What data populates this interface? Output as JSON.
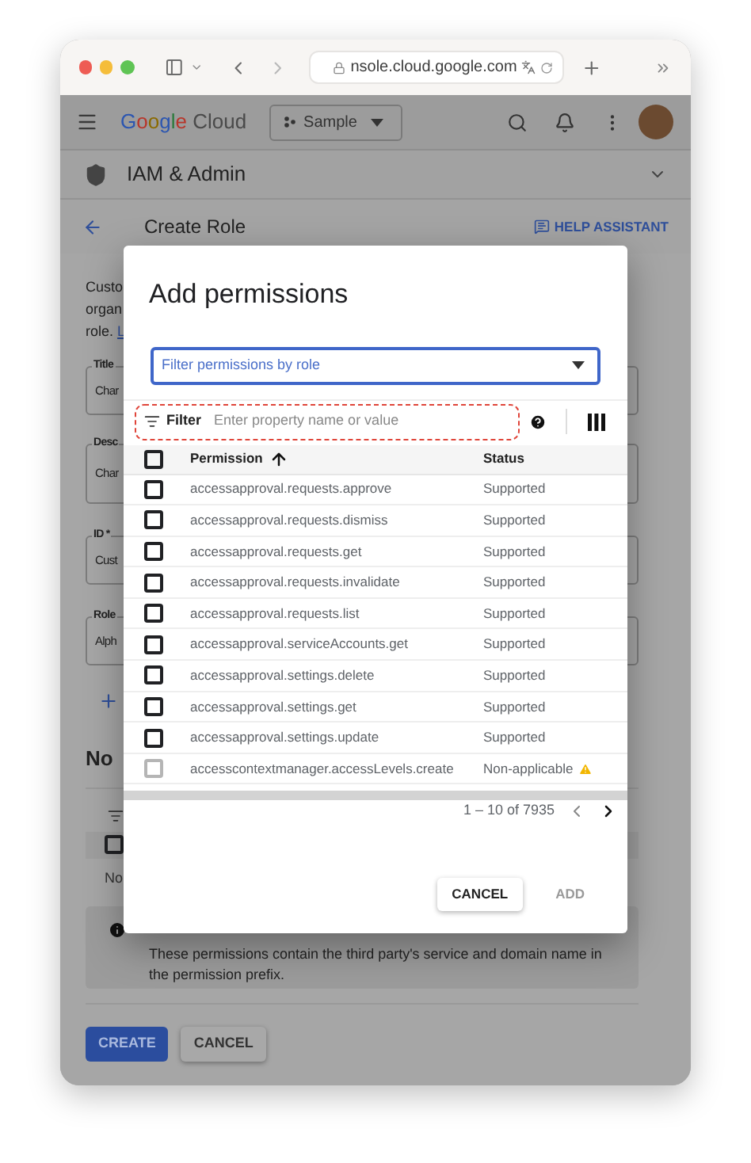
{
  "browser": {
    "url": "nsole.cloud.google.com"
  },
  "app_bar": {
    "brand": "Google",
    "product": "Cloud",
    "project": "Sample"
  },
  "section": {
    "title": "IAM & Admin"
  },
  "page": {
    "title": "Create Role",
    "help": "HELP ASSISTANT"
  },
  "form": {
    "intro_lines": [
      "Custo",
      "organ",
      "role."
    ],
    "intro_link": "L",
    "fields": [
      {
        "label": "Title",
        "value": "Char"
      },
      {
        "label": "Desc",
        "value": "Char"
      },
      {
        "label": "ID *",
        "value": "Cust"
      },
      {
        "label": "Role",
        "value": "Alph"
      }
    ],
    "heading": "No",
    "select_all": {
      "checked": false
    },
    "empty_text": "No",
    "info": "These permissions contain the third party's service and domain name in the permission prefix.",
    "buttons": [
      {
        "label": "CREATE",
        "kind": "primary"
      },
      {
        "label": "CANCEL",
        "kind": "secondary"
      }
    ]
  },
  "dialog": {
    "title": "Add permissions",
    "role_filter": {
      "placeholder": "Filter permissions by role"
    },
    "filter": {
      "label": "Filter",
      "placeholder": "Enter property name or value"
    },
    "select_all": {
      "checked": false
    },
    "columns": [
      "Permission",
      "Status"
    ],
    "rows": [
      {
        "permission": "accessapproval.requests.approve",
        "status": "Supported",
        "kind": "supported",
        "checked": false
      },
      {
        "permission": "accessapproval.requests.dismiss",
        "status": "Supported",
        "kind": "supported",
        "checked": false
      },
      {
        "permission": "accessapproval.requests.get",
        "status": "Supported",
        "kind": "supported",
        "checked": false
      },
      {
        "permission": "accessapproval.requests.invalidate",
        "status": "Supported",
        "kind": "supported",
        "checked": false
      },
      {
        "permission": "accessapproval.requests.list",
        "status": "Supported",
        "kind": "supported",
        "checked": false
      },
      {
        "permission": "accessapproval.serviceAccounts.get",
        "status": "Supported",
        "kind": "supported",
        "checked": false
      },
      {
        "permission": "accessapproval.settings.delete",
        "status": "Supported",
        "kind": "supported",
        "checked": false
      },
      {
        "permission": "accessapproval.settings.get",
        "status": "Supported",
        "kind": "supported",
        "checked": false
      },
      {
        "permission": "accessapproval.settings.update",
        "status": "Supported",
        "kind": "supported",
        "checked": false
      },
      {
        "permission": "accesscontextmanager.accessLevels.create",
        "status": "Non-applicable",
        "kind": "non_applicable",
        "checked": false
      }
    ],
    "pagination": "1 – 10 of 7935",
    "buttons": [
      {
        "label": "CANCEL",
        "disabled": false
      },
      {
        "label": "ADD",
        "disabled": true
      }
    ]
  }
}
